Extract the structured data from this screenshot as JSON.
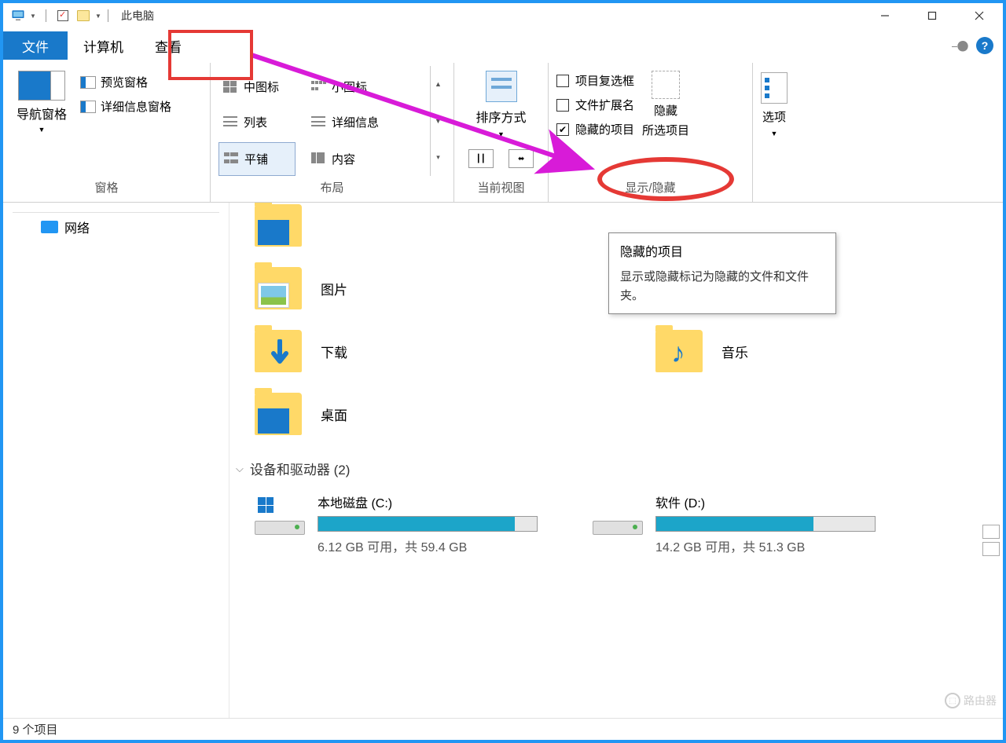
{
  "title": "此电脑",
  "tabs": {
    "file": "文件",
    "computer": "计算机",
    "view": "查看"
  },
  "ribbon": {
    "panes": {
      "group_label": "窗格",
      "nav": "导航窗格",
      "preview": "预览窗格",
      "details": "详细信息窗格"
    },
    "layout": {
      "group_label": "布局",
      "medium": "中图标",
      "small": "小图标",
      "list": "列表",
      "details": "详细信息",
      "tiles": "平铺",
      "content": "内容"
    },
    "current": {
      "group_label": "当前视图",
      "sort": "排序方式"
    },
    "showhide": {
      "group_label": "显示/隐藏",
      "item_checkboxes": "项目复选框",
      "file_ext": "文件扩展名",
      "hidden_items": "隐藏的项目",
      "hide": "隐藏",
      "hide_sub": "所选项目"
    },
    "options": {
      "label": "选项"
    }
  },
  "tooltip": {
    "title": "隐藏的项目",
    "body": "显示或隐藏标记为隐藏的文件和文件夹。"
  },
  "sidebar": {
    "network": "网络"
  },
  "folders": {
    "pictures": "图片",
    "downloads": "下载",
    "desktop": "桌面",
    "music": "音乐"
  },
  "section": {
    "devices": "设备和驱动器 (2)"
  },
  "drives": {
    "c": {
      "name": "本地磁盘 (C:)",
      "stat": "6.12 GB 可用，共 59.4 GB",
      "fill_pct": 90
    },
    "d": {
      "name": "软件 (D:)",
      "stat": "14.2 GB 可用，共 51.3 GB",
      "fill_pct": 72
    }
  },
  "status": "9 个项目",
  "watermark": "路由器"
}
